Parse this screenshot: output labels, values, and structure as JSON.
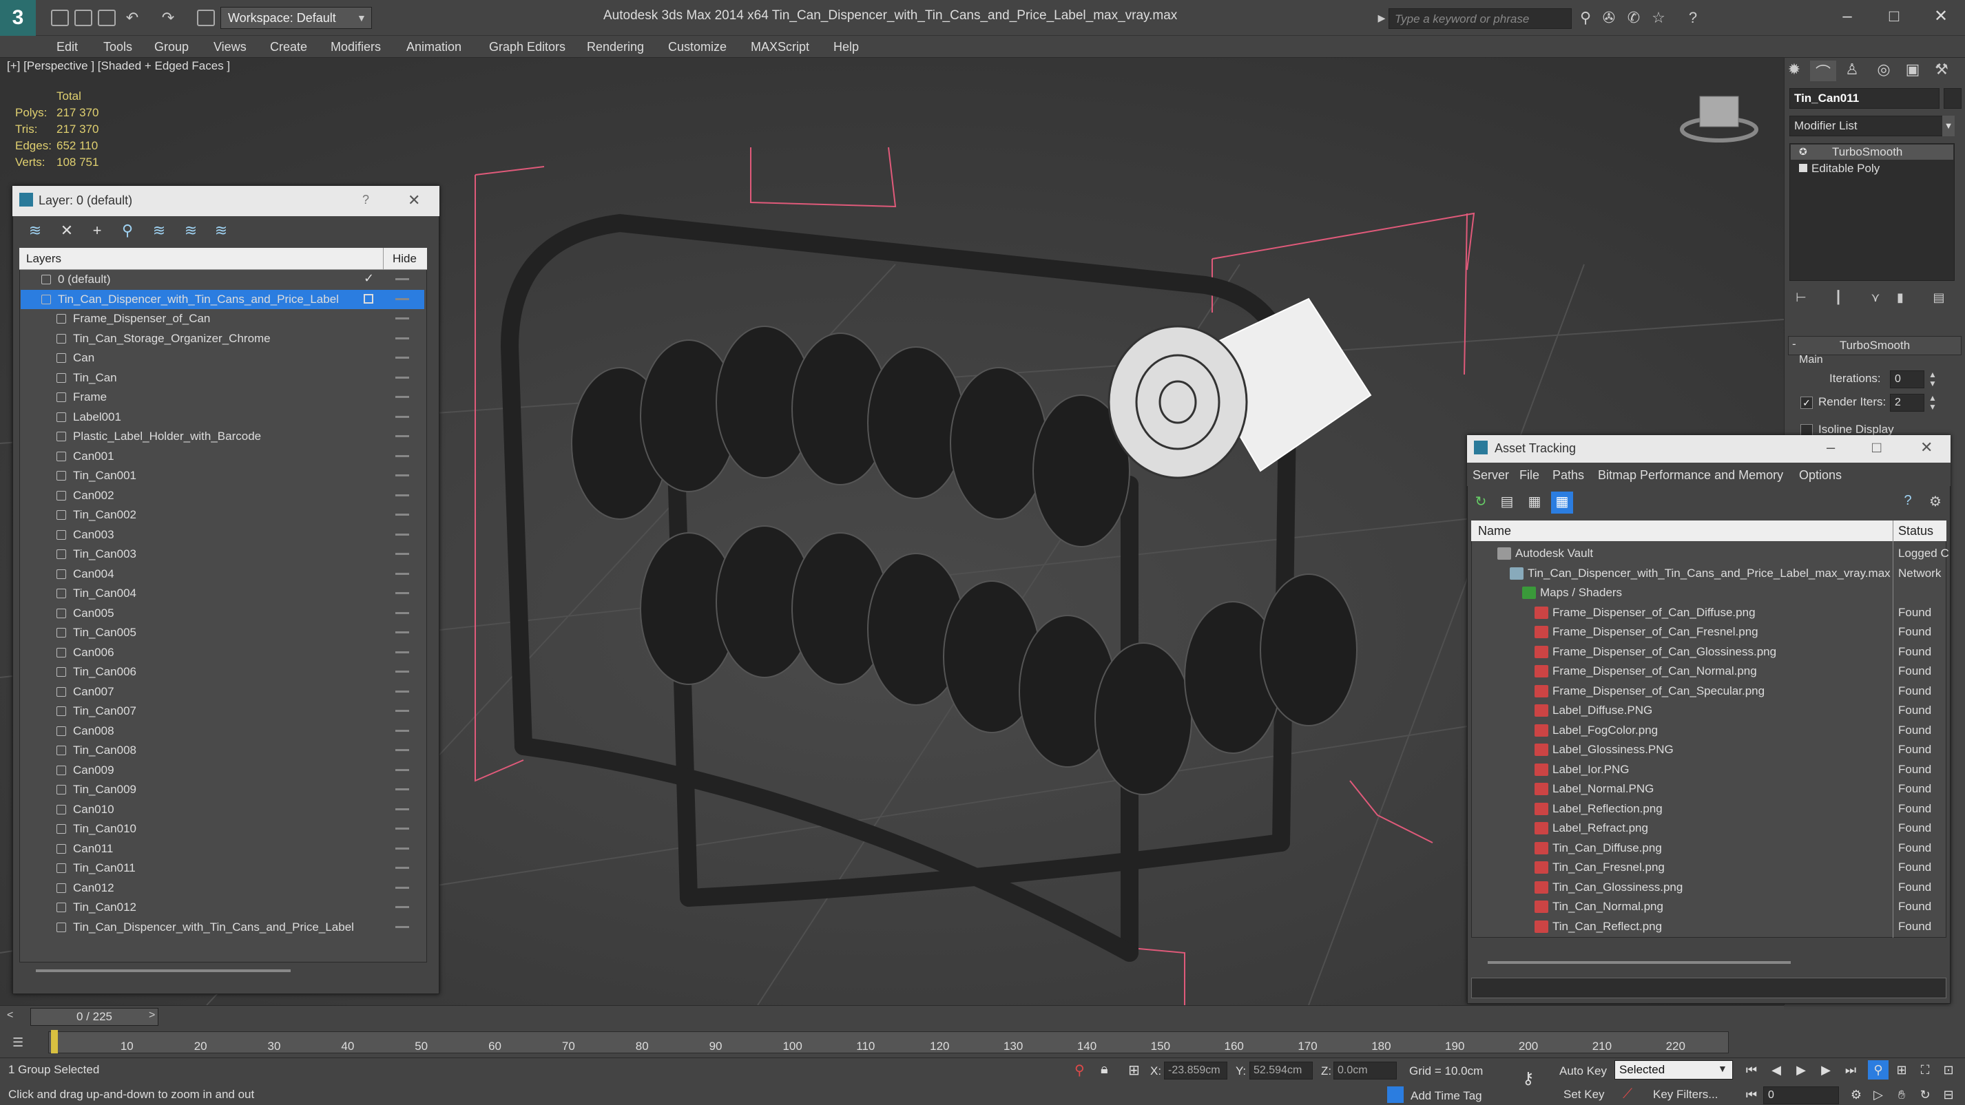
{
  "app": {
    "title": "Autodesk 3ds Max  2014 x64     Tin_Can_Dispencer_with_Tin_Cans_and_Price_Label_max_vray.max",
    "logo": "3",
    "workspace": "Workspace: Default",
    "search_placeholder": "Type a keyword or phrase"
  },
  "menu": [
    "Edit",
    "Tools",
    "Group",
    "Views",
    "Create",
    "Modifiers",
    "Animation",
    "Graph Editors",
    "Rendering",
    "Customize",
    "MAXScript",
    "Help"
  ],
  "viewport": {
    "label": "[+] [Perspective ] [Shaded + Edged Faces ]",
    "stats": {
      "total_label": "Total",
      "rows": [
        {
          "k": "Polys:",
          "v": "217 370"
        },
        {
          "k": "Tris:",
          "v": "217 370"
        },
        {
          "k": "Edges:",
          "v": "652 110"
        },
        {
          "k": "Verts:",
          "v": "108 751"
        }
      ]
    }
  },
  "command_panel": {
    "object_name": "Tin_Can011",
    "modifier_list": "Modifier List",
    "stack": [
      "TurboSmooth",
      "Editable Poly"
    ],
    "rollout_title": "TurboSmooth",
    "main_label": "Main",
    "iterations_label": "Iterations:",
    "iterations_value": "0",
    "render_iters_label": "Render Iters:",
    "render_iters_value": "2",
    "isoline_label": "Isoline Display"
  },
  "layer_panel": {
    "title": "Layer: 0 (default)",
    "help": "?",
    "close": "✕",
    "col_layers": "Layers",
    "col_hide": "Hide",
    "rows": [
      "0 (default)",
      "Tin_Can_Dispencer_with_Tin_Cans_and_Price_Label",
      "Frame_Dispenser_of_Can",
      "Tin_Can_Storage_Organizer_Chrome",
      "Can",
      "Tin_Can",
      "Frame",
      "Label001",
      "Plastic_Label_Holder_with_Barcode",
      "Can001",
      "Tin_Can001",
      "Can002",
      "Tin_Can002",
      "Can003",
      "Tin_Can003",
      "Can004",
      "Tin_Can004",
      "Can005",
      "Tin_Can005",
      "Can006",
      "Tin_Can006",
      "Can007",
      "Tin_Can007",
      "Can008",
      "Tin_Can008",
      "Can009",
      "Tin_Can009",
      "Can010",
      "Tin_Can010",
      "Can011",
      "Tin_Can011",
      "Can012",
      "Tin_Can012",
      "Tin_Can_Dispencer_with_Tin_Cans_and_Price_Label"
    ]
  },
  "asset_panel": {
    "title": "Asset Tracking",
    "menu": [
      "Server",
      "File",
      "Paths",
      "Bitmap Performance and Memory",
      "Options"
    ],
    "col_name": "Name",
    "col_status": "Status",
    "rows": [
      {
        "name": "Autodesk Vault",
        "status": "Logged C",
        "indent": 0,
        "icon": "vault"
      },
      {
        "name": "Tin_Can_Dispencer_with_Tin_Cans_and_Price_Label_max_vray.max",
        "status": "Network",
        "indent": 1,
        "icon": "max"
      },
      {
        "name": "Maps / Shaders",
        "status": "",
        "indent": 2,
        "icon": "folder"
      },
      {
        "name": "Frame_Dispenser_of_Can_Diffuse.png",
        "status": "Found",
        "indent": 3,
        "icon": "png"
      },
      {
        "name": "Frame_Dispenser_of_Can_Fresnel.png",
        "status": "Found",
        "indent": 3,
        "icon": "png"
      },
      {
        "name": "Frame_Dispenser_of_Can_Glossiness.png",
        "status": "Found",
        "indent": 3,
        "icon": "png"
      },
      {
        "name": "Frame_Dispenser_of_Can_Normal.png",
        "status": "Found",
        "indent": 3,
        "icon": "png"
      },
      {
        "name": "Frame_Dispenser_of_Can_Specular.png",
        "status": "Found",
        "indent": 3,
        "icon": "png"
      },
      {
        "name": "Label_Diffuse.PNG",
        "status": "Found",
        "indent": 3,
        "icon": "png"
      },
      {
        "name": "Label_FogColor.png",
        "status": "Found",
        "indent": 3,
        "icon": "png"
      },
      {
        "name": "Label_Glossiness.PNG",
        "status": "Found",
        "indent": 3,
        "icon": "png"
      },
      {
        "name": "Label_Ior.PNG",
        "status": "Found",
        "indent": 3,
        "icon": "png"
      },
      {
        "name": "Label_Normal.PNG",
        "status": "Found",
        "indent": 3,
        "icon": "png"
      },
      {
        "name": "Label_Reflection.png",
        "status": "Found",
        "indent": 3,
        "icon": "png"
      },
      {
        "name": "Label_Refract.png",
        "status": "Found",
        "indent": 3,
        "icon": "png"
      },
      {
        "name": "Tin_Can_Diffuse.png",
        "status": "Found",
        "indent": 3,
        "icon": "png"
      },
      {
        "name": "Tin_Can_Fresnel.png",
        "status": "Found",
        "indent": 3,
        "icon": "png"
      },
      {
        "name": "Tin_Can_Glossiness.png",
        "status": "Found",
        "indent": 3,
        "icon": "png"
      },
      {
        "name": "Tin_Can_Normal.png",
        "status": "Found",
        "indent": 3,
        "icon": "png"
      },
      {
        "name": "Tin_Can_Reflect.png",
        "status": "Found",
        "indent": 3,
        "icon": "png"
      }
    ]
  },
  "timeline": {
    "slider": "0 / 225",
    "ticks": [
      "10",
      "20",
      "30",
      "40",
      "50",
      "60",
      "70",
      "80",
      "90",
      "100",
      "110",
      "120",
      "130",
      "140",
      "150",
      "160",
      "170",
      "180",
      "190",
      "200",
      "210",
      "220"
    ]
  },
  "status": {
    "selection": "1 Group Selected",
    "prompt": "Click and drag up-and-down to zoom in and out",
    "x_label": "X:",
    "x_value": "-23.859cm",
    "y_label": "Y:",
    "y_value": "52.594cm",
    "z_label": "Z:",
    "z_value": "0.0cm",
    "grid": "Grid = 10.0cm",
    "auto_key": "Auto Key",
    "set_key": "Set Key",
    "selected": "Selected",
    "key_filters": "Key Filters...",
    "add_time_tag": "Add Time Tag",
    "frame": "0"
  },
  "colors": {
    "selection_blue": "#2b7de0",
    "stats_yellow": "#e0d070",
    "bbox_pink": "#e05a7a"
  }
}
